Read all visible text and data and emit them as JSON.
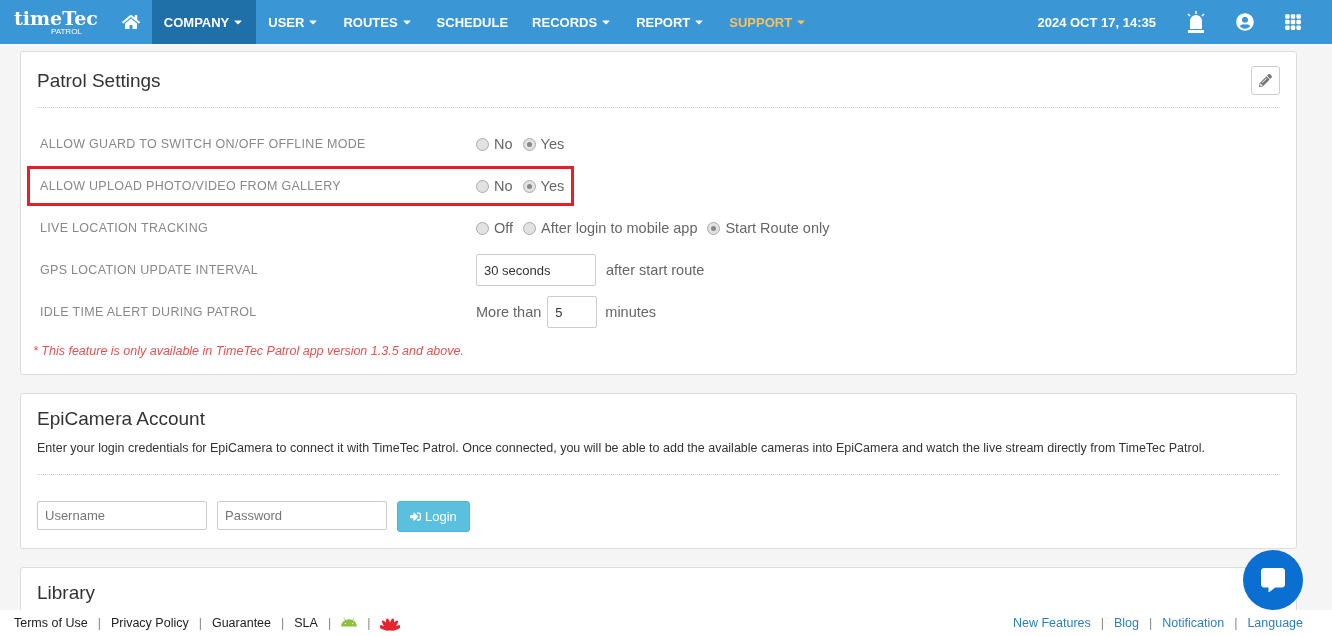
{
  "navbar": {
    "logo": {
      "text": "timeTec",
      "sub": "PATROL"
    },
    "items": [
      {
        "label": "COMPANY",
        "dropdown": true,
        "selected": true,
        "accent": false
      },
      {
        "label": "USER",
        "dropdown": true,
        "selected": false,
        "accent": false
      },
      {
        "label": "ROUTES",
        "dropdown": true,
        "selected": false,
        "accent": false
      },
      {
        "label": "SCHEDULE",
        "dropdown": false,
        "selected": false,
        "accent": false
      },
      {
        "label": "RECORDS",
        "dropdown": true,
        "selected": false,
        "accent": false
      },
      {
        "label": "REPORT",
        "dropdown": true,
        "selected": false,
        "accent": false
      },
      {
        "label": "SUPPORT",
        "dropdown": true,
        "selected": false,
        "accent": true
      }
    ],
    "datetime": "2024 OCT 17, 14:35"
  },
  "patrol_settings": {
    "title": "Patrol Settings",
    "rows": [
      {
        "kind": "radio",
        "label": "ALLOW GUARD TO SWITCH ON/OFF OFFLINE MODE",
        "highlighted": false,
        "options": [
          {
            "label": "No",
            "selected": false
          },
          {
            "label": "Yes",
            "selected": true
          }
        ]
      },
      {
        "kind": "radio",
        "label": "ALLOW UPLOAD PHOTO/VIDEO FROM GALLERY",
        "highlighted": true,
        "options": [
          {
            "label": "No",
            "selected": false
          },
          {
            "label": "Yes",
            "selected": true
          }
        ]
      },
      {
        "kind": "radio",
        "label": "LIVE LOCATION TRACKING",
        "highlighted": false,
        "options": [
          {
            "label": "Off",
            "selected": false
          },
          {
            "label": "After login to mobile app",
            "selected": false
          },
          {
            "label": "Start Route only",
            "selected": true
          }
        ]
      },
      {
        "kind": "input",
        "label": "GPS LOCATION UPDATE INTERVAL",
        "highlighted": false,
        "value": "30 seconds",
        "suffix": "after start route"
      },
      {
        "kind": "number",
        "label": "IDLE TIME ALERT DURING PATROL",
        "highlighted": false,
        "prefix": "More than",
        "value": "5",
        "suffix": "minutes"
      }
    ],
    "note": "* This feature is only available in TimeTec Patrol app version 1.3.5 and above."
  },
  "epicamera": {
    "title": "EpiCamera Account",
    "description": "Enter your login credentials for EpiCamera to connect it with TimeTec Patrol. Once connected, you will be able to add the available cameras into EpiCamera and watch the live stream directly from TimeTec Patrol.",
    "username": {
      "placeholder": "Username"
    },
    "password": {
      "placeholder": "Password"
    },
    "login_button": "Login"
  },
  "library": {
    "title": "Library"
  },
  "footer": {
    "separator": "|",
    "left_links": [
      "Terms of Use",
      "Privacy Policy",
      "Guarantee",
      "SLA"
    ],
    "right_links": [
      "New Features",
      "Blog",
      "Notification",
      "Language"
    ]
  }
}
